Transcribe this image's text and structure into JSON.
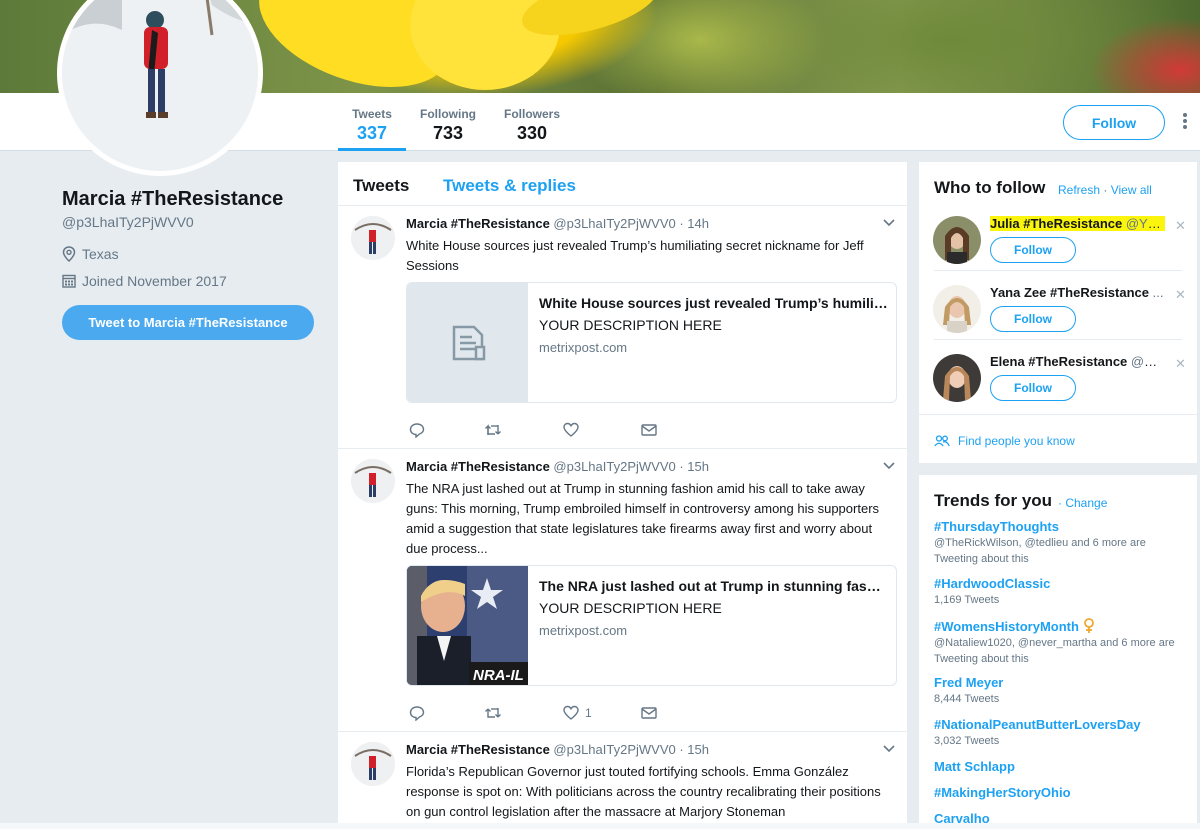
{
  "profile": {
    "name": "Marcia #TheResistance",
    "handle": "@p3LhaITy2PjWVV0",
    "location": "Texas",
    "joined": "Joined November 2017",
    "tweet_to_label": "Tweet to Marcia #TheResistance"
  },
  "nav": {
    "stats": [
      {
        "label": "Tweets",
        "value": "337"
      },
      {
        "label": "Following",
        "value": "733"
      },
      {
        "label": "Followers",
        "value": "330"
      }
    ],
    "follow_label": "Follow"
  },
  "timeline": {
    "tabs": [
      "Tweets",
      "Tweets & replies"
    ],
    "tweets": [
      {
        "name": "Marcia #TheResistance",
        "handle": "@p3LhaITy2PjWVV0 · 14h",
        "text": "White House sources just revealed Trump’s humiliating secret nickname for Jeff Sessions",
        "card": {
          "title": "White House sources just revealed Trump’s humiliating secret nickname for Jeff Sessions",
          "description": "YOUR DESCRIPTION HERE",
          "url": "metrixpost.com"
        },
        "like_count": ""
      },
      {
        "name": "Marcia #TheResistance",
        "handle": "@p3LhaITy2PjWVV0 · 15h",
        "text": "The NRA just lashed out at Trump in stunning fashion amid his call to take away guns: This morning, Trump embroiled himself in controversy among his supporters amid a suggestion that state legislatures take firearms away first and worry about due process...",
        "card": {
          "title": "The NRA just lashed out at Trump in stunning fashion amid his call to take away guns",
          "description": "YOUR DESCRIPTION HERE",
          "url": "metrixpost.com",
          "image_text": "NRA-IL"
        },
        "like_count": "1"
      },
      {
        "name": "Marcia #TheResistance",
        "handle": "@p3LhaITy2PjWVV0 · 15h",
        "text": "Florida’s Republican Governor just touted fortifying schools. Emma González response is spot on: With politicians across the country recalibrating their positions on gun control legislation after the massacre at Marjory Stoneman"
      }
    ]
  },
  "who_to_follow": {
    "title": "Who to follow",
    "refresh": "Refresh",
    "separator": "·",
    "view_all": "View all",
    "users": [
      {
        "name": "Julia #TheResistance",
        "handle": "@YE...",
        "follow": "Follow"
      },
      {
        "name": "Yana Zee #TheResistance",
        "handle": "...",
        "follow": "Follow"
      },
      {
        "name": "Elena #TheResistance",
        "handle": "@El...",
        "follow": "Follow"
      }
    ],
    "find_people": "Find people you know"
  },
  "trends": {
    "title": "Trends for you",
    "change": "Change",
    "items": [
      {
        "tag": "#ThursdayThoughts",
        "meta": "@TheRickWilson, @tedlieu and 6 more are Tweeting about this"
      },
      {
        "tag": "#HardwoodClassic",
        "meta": "1,169 Tweets"
      },
      {
        "tag": "#WomensHistoryMonth",
        "meta": "@Nataliew1020, @never_martha and 6 more are Tweeting about this"
      },
      {
        "tag": "Fred Meyer",
        "meta": "8,444 Tweets"
      },
      {
        "tag": "#NationalPeanutButterLoversDay",
        "meta": "3,032 Tweets"
      },
      {
        "tag": "Matt Schlapp",
        "meta": ""
      },
      {
        "tag": "#MakingHerStoryOhio",
        "meta": ""
      },
      {
        "tag": "Carvalho",
        "meta": ""
      }
    ]
  },
  "colors": {
    "accent": "#1da1f2",
    "highlight": "#fbf50d",
    "text_secondary": "#657786"
  }
}
